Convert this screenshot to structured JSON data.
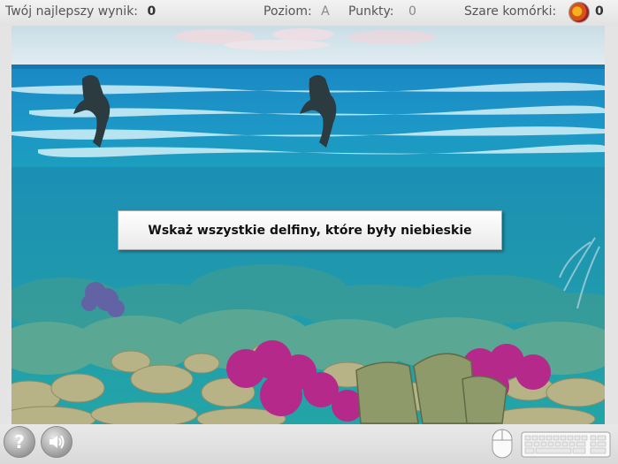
{
  "status_bar": {
    "best_score_label": "Twój najlepszy wynik:",
    "best_score_value": "0",
    "level_label": "Poziom:",
    "level_value": "A",
    "points_label": "Punkty:",
    "points_value": "0",
    "gray_cells_label": "Szare komórki:",
    "gray_cells_value": "0"
  },
  "game": {
    "instruction": "Wskaż wszystkie delfiny, które były niebieskie",
    "dolphin_count": 2
  },
  "bottom_bar": {
    "help_glyph": "?",
    "sound_icon": "speaker-icon",
    "mouse_icon": "mouse-icon",
    "keyboard_icon": "keyboard-icon"
  }
}
